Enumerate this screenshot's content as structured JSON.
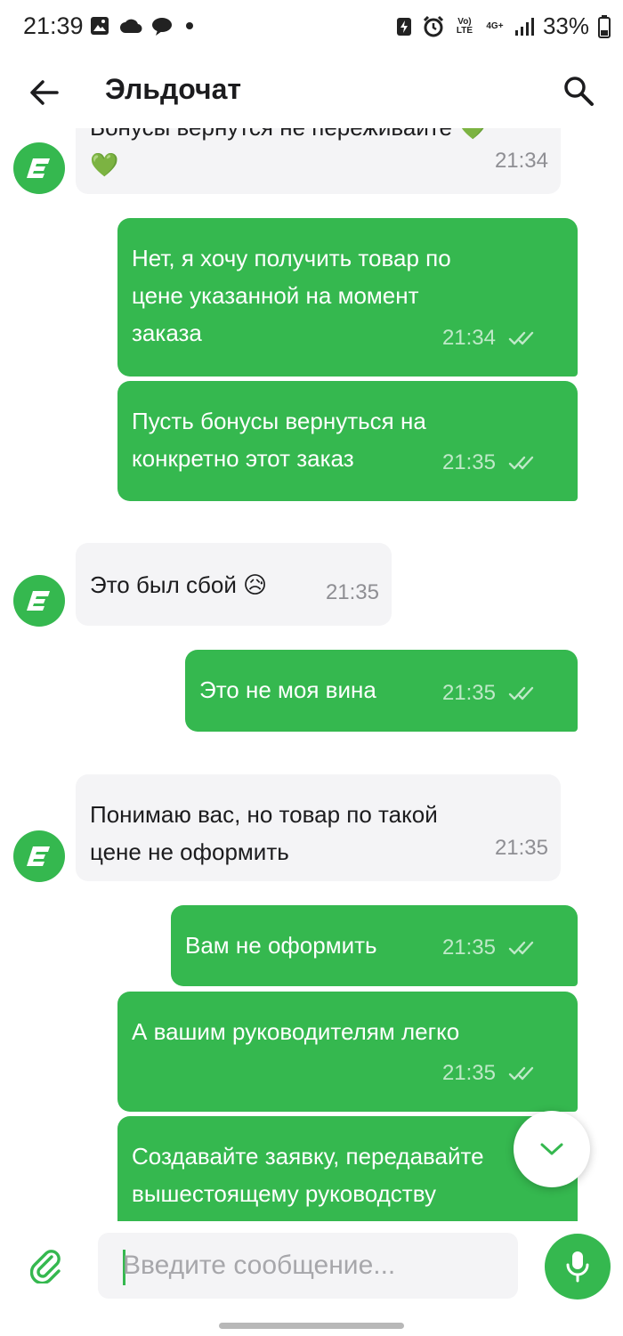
{
  "status_bar": {
    "time": "21:39",
    "battery": "33%",
    "network_volte": "Vo) LTE",
    "network_4g": "4G+"
  },
  "header": {
    "title": "Эльдочат"
  },
  "colors": {
    "accent": "#35b84f",
    "incoming_bubble": "#f4f4f6",
    "outgoing_text": "#ffffff",
    "outgoing_time": "#bfe9c8"
  },
  "messages": [
    {
      "direction": "incoming",
      "text": "Бонусы вернутся не переживайте 💚\n💚",
      "time": "21:34"
    },
    {
      "direction": "outgoing",
      "text": "Нет, я хочу получить товар по\nцене указанной на момент\nзаказа",
      "time": "21:34"
    },
    {
      "direction": "outgoing",
      "text": "Пусть бонусы вернуться на\nконкретно этот заказ",
      "time": "21:35"
    },
    {
      "direction": "incoming",
      "text": "Это был сбой 😥",
      "time": "21:35"
    },
    {
      "direction": "outgoing",
      "text": "Это не моя вина",
      "time": "21:35"
    },
    {
      "direction": "incoming",
      "text": "Понимаю вас, но товар по такой\nцене не оформить",
      "time": "21:35"
    },
    {
      "direction": "outgoing",
      "text": "Вам не оформить",
      "time": "21:35"
    },
    {
      "direction": "outgoing",
      "text": "А вашим руководителям легко",
      "time": "21:35"
    },
    {
      "direction": "outgoing",
      "text": "Создавайте заявку, передавайте\nвышестоящему руководству",
      "time": ""
    }
  ],
  "input": {
    "placeholder": "Введите сообщение..."
  },
  "icons": {
    "back": "arrow-left-icon",
    "search": "search-icon",
    "attach": "paperclip-icon",
    "mic": "microphone-icon",
    "scroll_down": "chevron-down-icon",
    "read": "double-check-icon"
  }
}
